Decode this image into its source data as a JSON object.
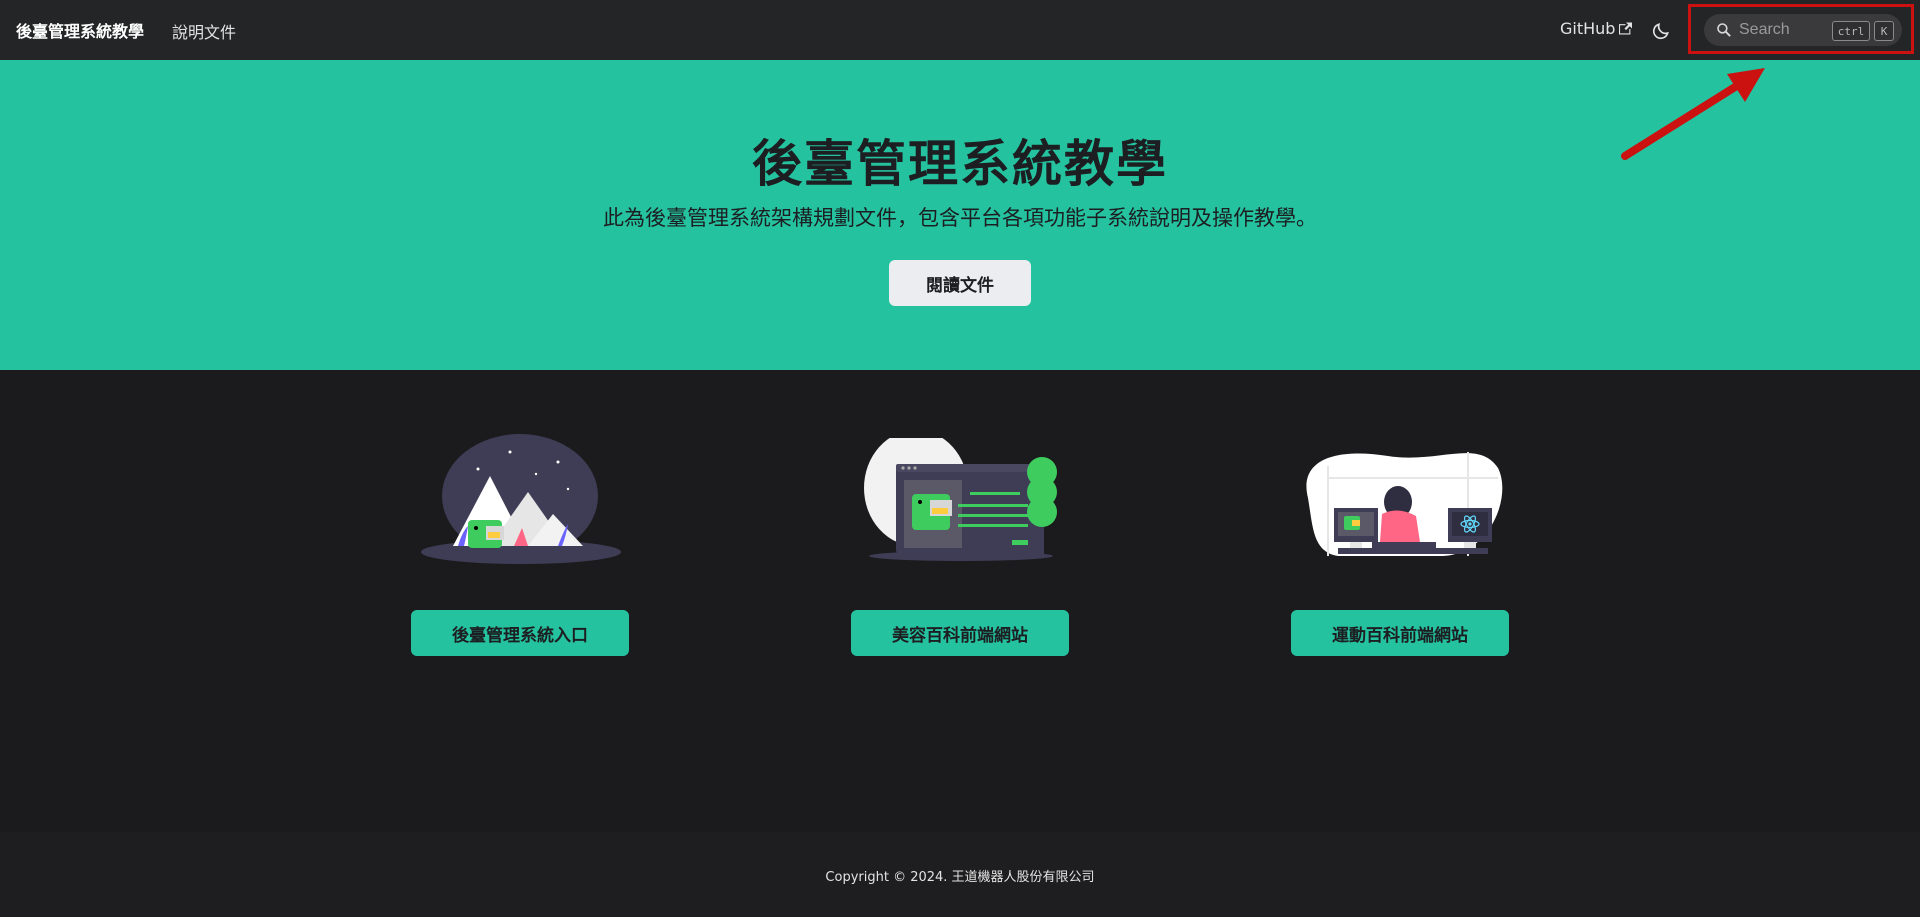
{
  "navbar": {
    "brand": "後臺管理系統教學",
    "docs_link": "說明文件",
    "github_link": "GitHub",
    "search": {
      "placeholder": "Search",
      "shortcut_ctrl": "ctrl",
      "shortcut_key": "K"
    }
  },
  "hero": {
    "title": "後臺管理系統教學",
    "subtitle": "此為後臺管理系統架構規劃文件，包含平台各項功能子系統說明及操作教學。",
    "button": "閱讀文件"
  },
  "features": [
    {
      "button": "後臺管理系統入口"
    },
    {
      "button": "美容百科前端網站"
    },
    {
      "button": "運動百科前端網站"
    }
  ],
  "footer": {
    "copyright": "Copyright © 2024. 王道機器人股份有限公司"
  },
  "colors": {
    "primary": "#25c2a0",
    "navbar_bg": "#242526",
    "page_bg": "#1b1b1d",
    "highlight": "#cc1111"
  }
}
